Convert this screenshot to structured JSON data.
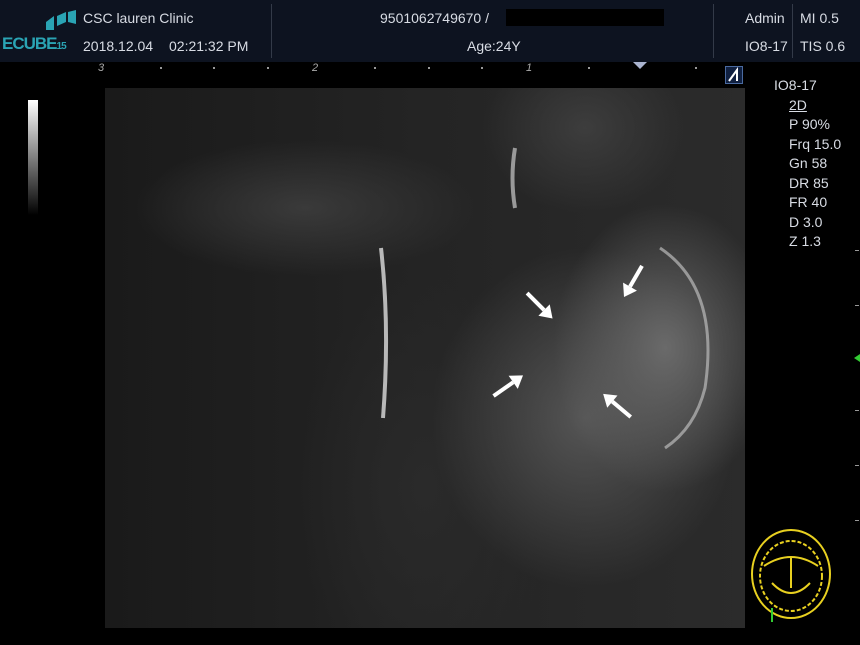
{
  "header": {
    "logo": "ECUBE15",
    "clinic": "CSC lauren Clinic",
    "date": "2018.12.04",
    "time": "02:21:32 PM",
    "patient_id": "9501062749670 /",
    "age": "Age:24Y",
    "user": "Admin",
    "probe": "IO8-17",
    "mi": "MI 0.5",
    "tis": "TIS 0.6"
  },
  "scale": {
    "marks": [
      "3",
      "2",
      "1"
    ]
  },
  "params": {
    "probe": "IO8-17",
    "mode": "2D",
    "power": "P 90%",
    "frequency": "Frq 15.0",
    "gain": "Gn 58",
    "dynamic_range": "DR 85",
    "frame_rate": "FR 40",
    "depth": "D 3.0",
    "zoom": "Z 1.3"
  },
  "colors": {
    "header_bg": "#0d1320",
    "logo": "#2aa4b4",
    "bodymark": "#e8d020"
  }
}
